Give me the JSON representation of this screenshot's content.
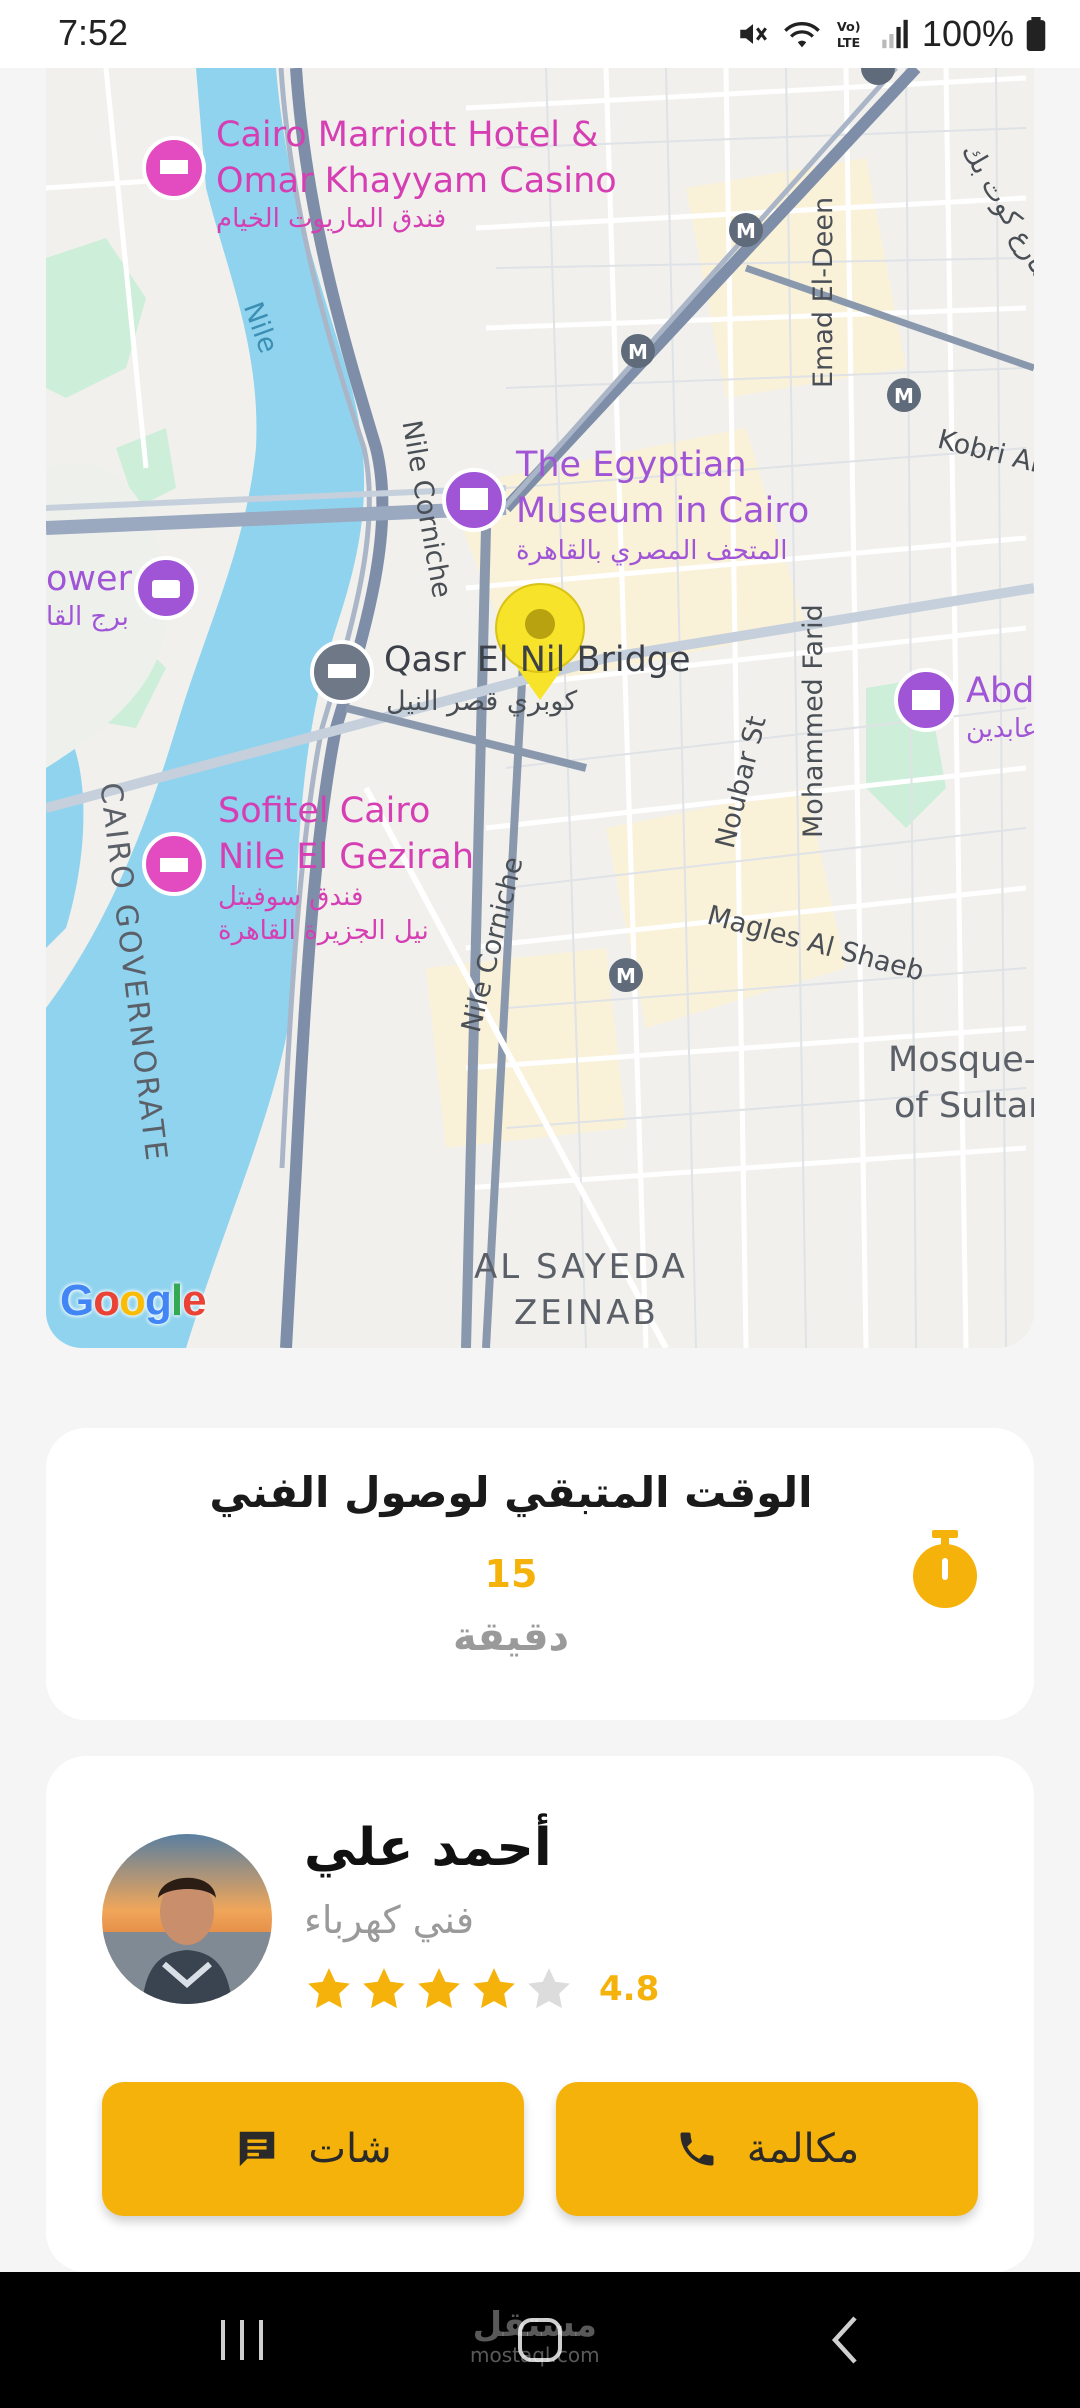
{
  "status_bar": {
    "time": "7:52",
    "battery": "100%",
    "icons": [
      "mute-icon",
      "wifi-icon",
      "volte-icon",
      "signal-icon",
      "battery-icon"
    ]
  },
  "map": {
    "pois": {
      "marriott_line1": "Cairo Marriott Hotel &",
      "marriott_line2": "Omar Khayyam Casino",
      "marriott_ar": "فندق الماريوت الخيام",
      "museum_line1": "The Egyptian",
      "museum_line2": "Museum in Cairo",
      "museum_ar": "المتحف المصري بالقاهرة",
      "tower": "ower",
      "tower_ar": "برج القا",
      "bridge": "Qasr El Nil Bridge",
      "bridge_ar": "كوبري قصر النيل",
      "sofitel_line1": "Sofitel Cairo",
      "sofitel_line2": "Nile El Gezirah",
      "sofitel_ar1": "فندق سوفيتل",
      "sofitel_ar2": "نيل الجزيرة القاهرة",
      "abdeen": "Abd",
      "abdeen_ar": "عابدين",
      "mosque_line1": "Mosque-",
      "mosque_line2": "of Sultan"
    },
    "roads": {
      "nile": "Nile",
      "nile_corniche_1": "Nile Corniche",
      "nile_corniche_2": "Nile Corniche",
      "emad_el_deen": "Emad El-Deen",
      "kobri": "Kobri Al",
      "mohammed_farid": "Mohammed Farid",
      "noubar": "Noubar St",
      "magles": "Magles Al Shaeb",
      "kot_street": "شارع كوت بك"
    },
    "areas": {
      "cairo_gov": "CAIRO GOVERNORATE",
      "sayeda_line1": "AL SAYEDA",
      "sayeda_line2": "ZEINAB"
    },
    "google": [
      "G",
      "o",
      "o",
      "g",
      "l",
      "e"
    ],
    "colors": {
      "water": "#8fd3ee",
      "land": "#f1f0ec",
      "road": "#ffffff",
      "highway": "#7f8ea8",
      "pin": "#f6e32a"
    }
  },
  "eta": {
    "title": "الوقت المتبقي لوصول الفني",
    "value": "15",
    "unit": "دقيقة",
    "icon": "timer-icon"
  },
  "technician": {
    "name": "أحمد علي",
    "role": "فني كهرباء",
    "rating": "4.8",
    "stars_filled": 4,
    "stars_total": 5,
    "chat_label": "شات",
    "call_label": "مكالمة",
    "chat_icon": "chat-icon",
    "call_icon": "phone-icon"
  },
  "watermark": {
    "line1": "مستقل",
    "line2": "mostaql.com"
  },
  "accent_color": "#f5b20a"
}
